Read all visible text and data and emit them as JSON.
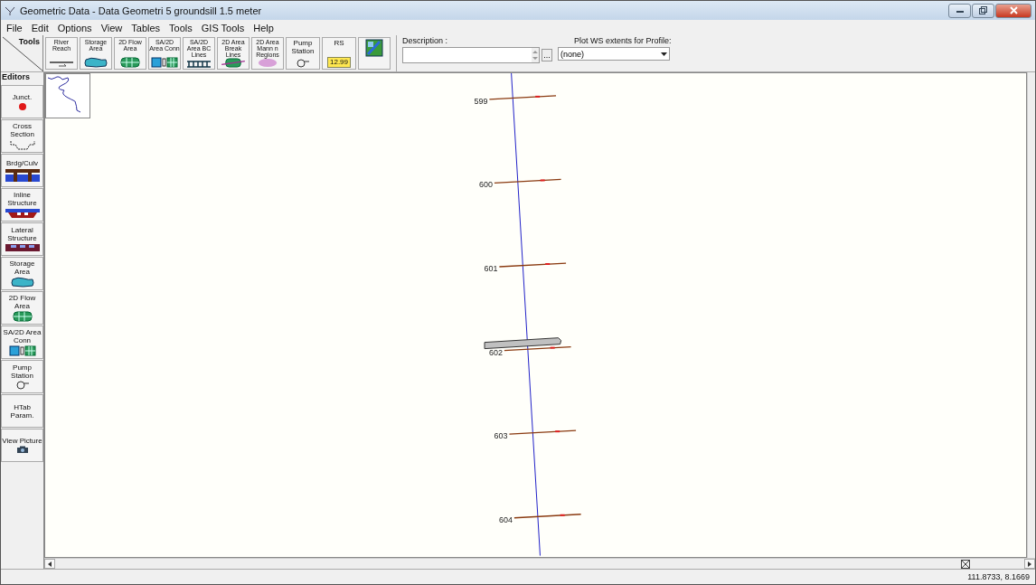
{
  "window": {
    "title": "Geometric Data - Data Geometri 5 groundsill 1.5 meter"
  },
  "menu": [
    "File",
    "Edit",
    "Options",
    "View",
    "Tables",
    "Tools",
    "GIS Tools",
    "Help"
  ],
  "tools_label": "Tools",
  "editors_label": "Editors",
  "tools": [
    {
      "label": "River Reach",
      "kind": "reach"
    },
    {
      "label": "Storage Area",
      "kind": "storage"
    },
    {
      "label": "2D Flow Area",
      "kind": "flow2d"
    },
    {
      "label": "SA/2D Area Conn",
      "kind": "conn"
    },
    {
      "label": "SA/2D Area BC Lines",
      "kind": "bcline"
    },
    {
      "label": "2D Area Break Lines",
      "kind": "breakline"
    },
    {
      "label": "2D Area Mann n Regions",
      "kind": "mann"
    },
    {
      "label": "Pump Station",
      "kind": "pump"
    },
    {
      "label": "RS",
      "kind": "rs",
      "badge": "12.99"
    },
    {
      "kind": "map"
    }
  ],
  "description": {
    "label": "Description :",
    "browse": "..."
  },
  "plot_ws": {
    "label": "Plot WS extents for Profile:",
    "value": "(none)"
  },
  "editors": [
    {
      "label": "Junct.",
      "kind": "junction"
    },
    {
      "label": "Cross Section",
      "kind": "xs"
    },
    {
      "label": "Brdg/Culv",
      "kind": "bridge"
    },
    {
      "label": "Inline Structure",
      "kind": "inline"
    },
    {
      "label": "Lateral Structure",
      "kind": "lateral"
    },
    {
      "label": "Storage Area",
      "kind": "storage"
    },
    {
      "label": "2D Flow Area",
      "kind": "flow2d"
    },
    {
      "label": "SA/2D Area Conn",
      "kind": "conn"
    },
    {
      "label": "Pump Station",
      "kind": "pump"
    },
    {
      "label": "HTab Param.",
      "kind": "text"
    },
    {
      "label": "View Picture",
      "kind": "camera"
    }
  ],
  "canvas": {
    "cross_sections": [
      {
        "label": "599",
        "structure": false
      },
      {
        "label": "600",
        "structure": false
      },
      {
        "label": "601",
        "structure": false
      },
      {
        "label": "602",
        "structure": true
      },
      {
        "label": "603",
        "structure": false
      },
      {
        "label": "604",
        "structure": false
      }
    ]
  },
  "status_bar": {
    "coordinates": "111.8733, 8.1669"
  }
}
